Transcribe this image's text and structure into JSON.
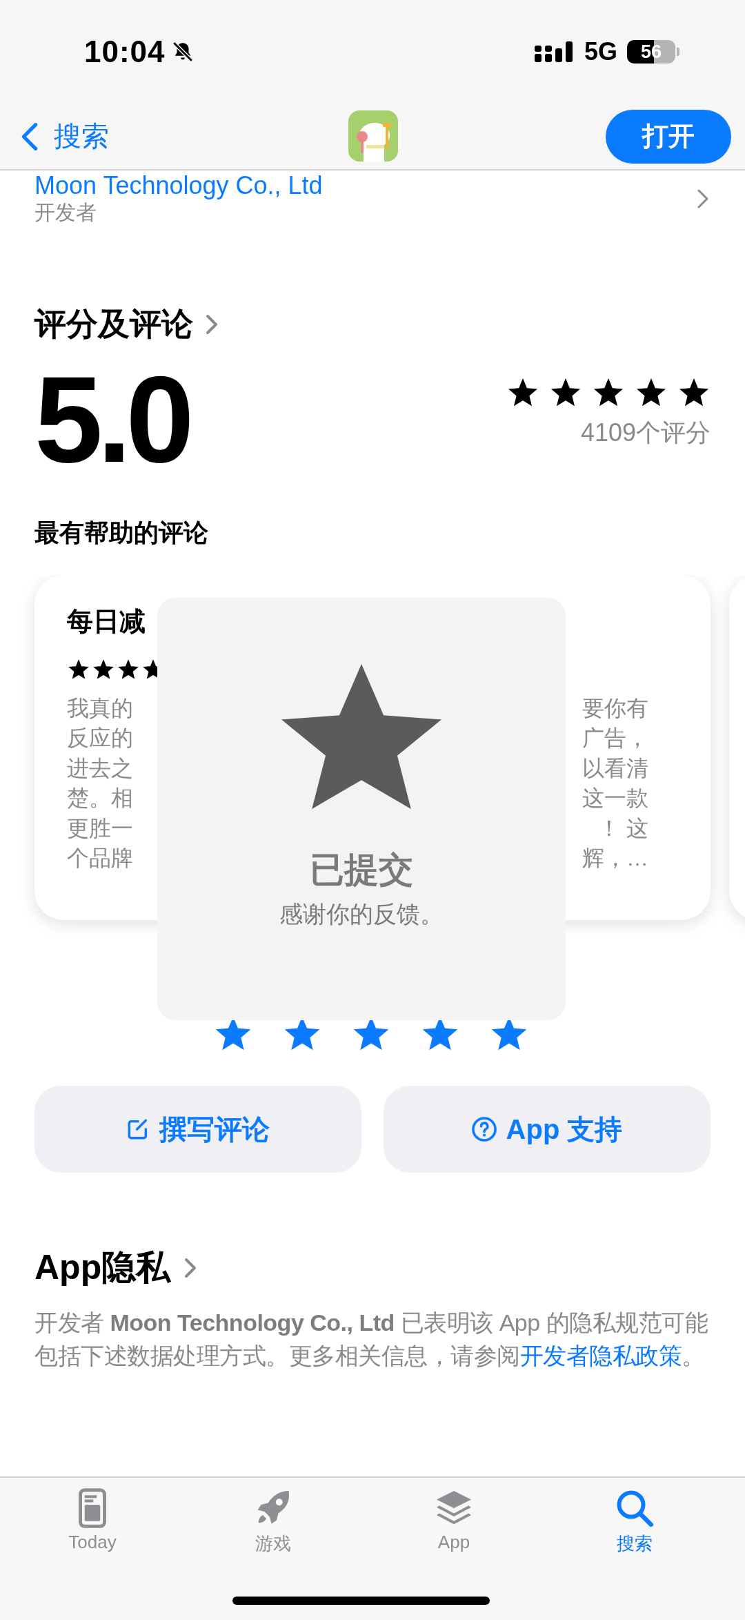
{
  "status_bar": {
    "time": "10:04",
    "network": "5G",
    "battery": "56"
  },
  "nav": {
    "back_label": "搜索",
    "open_button": "打开"
  },
  "developer": {
    "name": "Moon Technology Co., Ltd",
    "label": "开发者"
  },
  "ratings": {
    "title": "评分及评论",
    "score": "5.0",
    "stars": 5,
    "count": "4109个评分"
  },
  "reviews": {
    "title": "最有帮助的评论",
    "cards": [
      {
        "title": "每日减",
        "stars": 4,
        "lines": [
          {
            "left": "我真的",
            "right": "要你有"
          },
          {
            "left": "反应的",
            "right": "广告，"
          },
          {
            "left": "进去之",
            "right": "以看清"
          },
          {
            "left": "楚。相",
            "right": "这一款"
          },
          {
            "left": "更胜一",
            "right": "！ 这"
          },
          {
            "left": "个品牌",
            "right": "辉，…"
          }
        ]
      }
    ]
  },
  "toast": {
    "title": "已提交",
    "message": "感谢你的反馈。"
  },
  "tap_rating": {
    "stars": 5
  },
  "actions": [
    {
      "kind": "write",
      "label": "撰写评论"
    },
    {
      "kind": "support",
      "label": "App 支持"
    }
  ],
  "privacy": {
    "title": "App隐私",
    "text": "开发者 **Moon Technology Co., Ltd** 已表明该 App 的隐私规范可能包括下述数据处理方式。更多相关信息，请参阅",
    "link": "开发者隐私政策",
    "end": "。"
  },
  "tab_bar": [
    {
      "kind": "today",
      "label": "Today",
      "selected": false
    },
    {
      "kind": "games",
      "label": "游戏",
      "selected": false
    },
    {
      "kind": "apps",
      "label": "App",
      "selected": false
    },
    {
      "kind": "search",
      "label": "搜索",
      "selected": true
    }
  ]
}
